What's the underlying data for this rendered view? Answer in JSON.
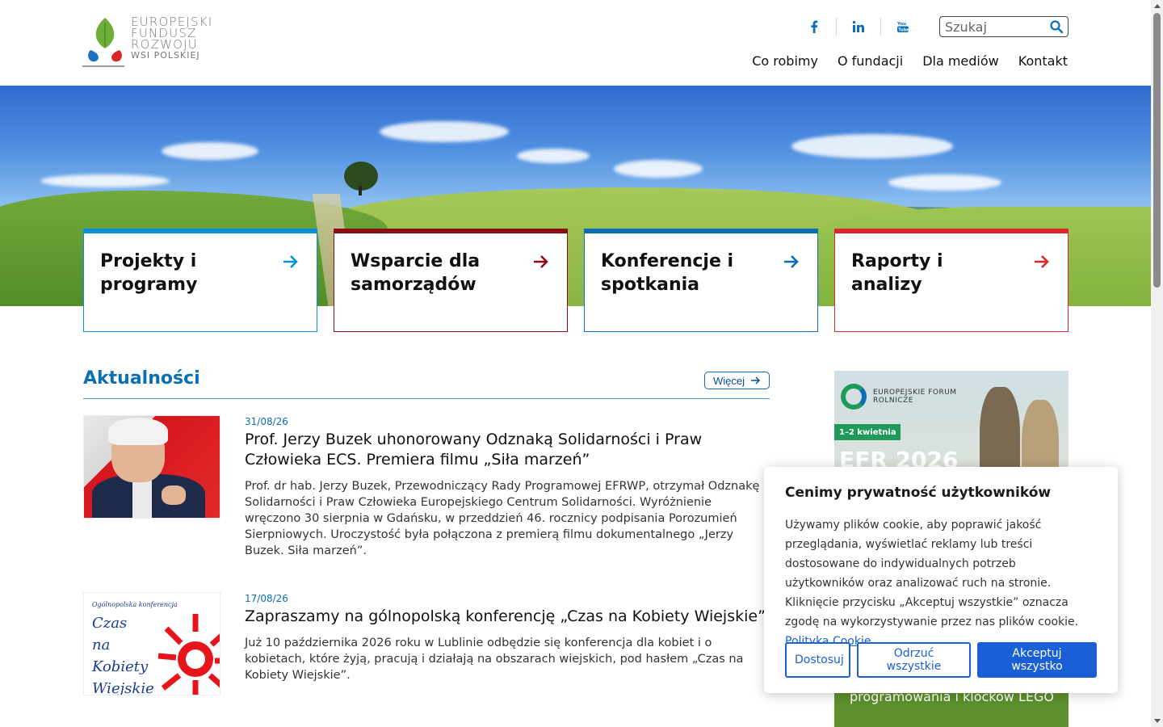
{
  "header": {
    "logo": {
      "line1": "EUROPEJSKI",
      "line2": "FUNDUSZ",
      "line3": "ROZWOJU",
      "line4": "WSI POLSKIEJ"
    },
    "social": [
      {
        "name": "facebook-icon",
        "glyph": "f"
      },
      {
        "name": "linkedin-icon",
        "glyph": "in"
      },
      {
        "name": "youtube-icon",
        "glyph": "You Tube"
      }
    ],
    "search": {
      "placeholder": "Szukaj",
      "value": ""
    },
    "nav": [
      "Co robimy",
      "O fundacji",
      "Dla mediów",
      "Kontakt"
    ]
  },
  "cards": [
    {
      "title": "Projekty i programy",
      "color": "#0b8fd6"
    },
    {
      "title": "Wsparcie dla samorządów",
      "color": "#8a0e14"
    },
    {
      "title": "Konferencje i spotkania",
      "color": "#0b6fb5"
    },
    {
      "title": "Raporty i analizy",
      "color": "#e0242e"
    }
  ],
  "news": {
    "heading": "Aktualności",
    "more_label": "Więcej",
    "items": [
      {
        "date": "31/08/26",
        "title": "Prof. Jerzy Buzek uhonorowany Odznaką Solidarności i Praw Człowieka ECS. Premiera filmu „Siła marzeń”",
        "text": "Prof. dr hab. Jerzy Buzek, Przewodniczący Rady Programowej EFRWP, otrzymał Odznakę Solidarności i Praw Człowieka Europejskiego Centrum Solidarności. Wyróżnienie wręczono 30 sierpnia w Gdańsku, w przeddzień 46. rocznicy podpisania Porozumień Sierpniowych. Uroczystość była połączona z premierą filmu dokumentalnego „Jerzy Buzek. Siła marzeń”."
      },
      {
        "date": "17/08/26",
        "title": "Zapraszamy na gólnopolską konferencję „Czas na Kobiety Wiejskie”",
        "text": "Już 10 października 2026 roku w Lublinie odbędzie się konferencja dla kobiet i o kobietach, które żyją, pracują i działają na obszarach wiejskich, pod hasłem „Czas na Kobiety Wiejskie”.",
        "thumb_small": "Ogólnopolska konferencja",
        "thumb_big": "Czas na Kobiety Wiejskie"
      }
    ]
  },
  "sidebar": {
    "forum_name": "EUROPEJSKIE FORUM ROLNICZE",
    "date_tag": "1–2 kwietnia",
    "year_text": "EFR 2026",
    "green_text": "programowania i klocków LEGO"
  },
  "cookie": {
    "title": "Cenimy prywatność użytkowników",
    "text": "Używamy plików cookie, aby poprawić jakość przeglądania, wyświetlać reklamy lub treści dostosowane do indywidualnych potrzeb użytkowników oraz analizować ruch na stronie. Kliknięcie przycisku „Akceptuj wszystkie” oznacza zgodę na wykorzystywanie przez nas plików cookie.",
    "link": "Polityka Cookie",
    "buttons": {
      "customize": "Dostosuj",
      "reject": "Odrzuć wszystkie",
      "accept": "Akceptuj wszystko"
    }
  },
  "colors": {
    "brand_blue": "#0b6fb5",
    "cookie_blue": "#1a5fd6",
    "green": "#5d8f2c"
  }
}
